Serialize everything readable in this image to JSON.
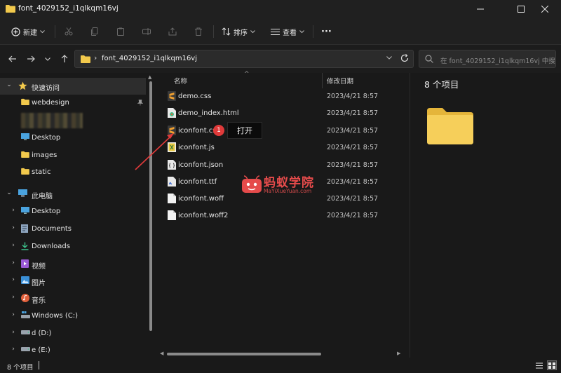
{
  "window": {
    "title": "font_4029152_i1qlkqm16vj",
    "controls": {
      "minimize": "—",
      "maximize": "☐",
      "close": "✕"
    }
  },
  "toolbar": {
    "new_label": "新建",
    "sort_label": "排序",
    "view_label": "查看",
    "more_label": "···"
  },
  "address": {
    "path": "font_4029152_i1qlkqm16vj",
    "search_placeholder": "在 font_4029152_i1qlkqm16vj 中搜..."
  },
  "sidebar": {
    "quick_access": "快速访问",
    "quick_items": [
      "webdesign",
      "Desktop",
      "images",
      "static"
    ],
    "this_pc": "此电脑",
    "pc_items": [
      "Desktop",
      "Documents",
      "Downloads",
      "视频",
      "图片",
      "音乐",
      "Windows (C:)",
      "d (D:)",
      "e (E:)"
    ]
  },
  "columns": {
    "name": "名称",
    "modified": "修改日期"
  },
  "files": [
    {
      "name": "demo.css",
      "date": "2023/4/21 8:57",
      "icon": "sublime-file-icon"
    },
    {
      "name": "demo_index.html",
      "date": "2023/4/21 8:57",
      "icon": "html-file-icon"
    },
    {
      "name": "iconfont.css",
      "date": "2023/4/21 8:57",
      "icon": "sublime-file-icon"
    },
    {
      "name": "iconfont.js",
      "date": "2023/4/21 8:57",
      "icon": "js-file-icon"
    },
    {
      "name": "iconfont.json",
      "date": "2023/4/21 8:57",
      "icon": "json-file-icon"
    },
    {
      "name": "iconfont.ttf",
      "date": "2023/4/21 8:57",
      "icon": "font-file-icon"
    },
    {
      "name": "iconfont.woff",
      "date": "2023/4/21 8:57",
      "icon": "blank-file-icon"
    },
    {
      "name": "iconfont.woff2",
      "date": "2023/4/21 8:57",
      "icon": "blank-file-icon"
    }
  ],
  "annotation": {
    "badge": "1",
    "tooltip": "打开"
  },
  "watermark": {
    "title": "蚂蚁学院",
    "subtitle": "MaYiXueYuan.com"
  },
  "details": {
    "count": "8 个项目"
  },
  "status": {
    "count": "8 个项目"
  },
  "colors": {
    "folder": "#f2c94c",
    "accent_red": "#e03a3a",
    "sublime": "#f0a030"
  }
}
